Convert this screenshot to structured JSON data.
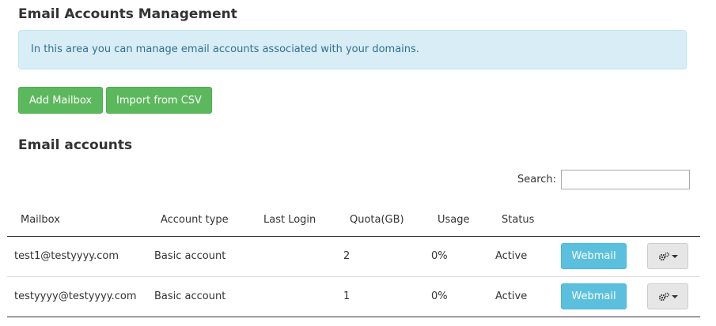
{
  "page": {
    "title": "Email Accounts Management",
    "info_text": "In this area you can manage email accounts associated with your domains."
  },
  "toolbar": {
    "add_label": "Add Mailbox",
    "import_label": "Import from CSV"
  },
  "accounts": {
    "section_title": "Email accounts",
    "search_label": "Search:",
    "search_value": "",
    "columns": [
      "Mailbox",
      "Account type",
      "Last Login",
      "Quota(GB)",
      "Usage",
      "Status"
    ],
    "rows": [
      {
        "mailbox": "test1@testyyyy.com",
        "account_type": "Basic account",
        "last_login": "",
        "quota": "2",
        "usage": "0%",
        "status": "Active",
        "webmail_label": "Webmail",
        "actions_icon": "gears-icon"
      },
      {
        "mailbox": "testyyyy@testyyyy.com",
        "account_type": "Basic account",
        "last_login": "",
        "quota": "1",
        "usage": "0%",
        "status": "Active",
        "webmail_label": "Webmail",
        "actions_icon": "gears-icon"
      }
    ]
  },
  "colors": {
    "success": "#5cb85c",
    "info_button": "#5bc0de",
    "info_bg": "#d9edf7",
    "info_text": "#31708f"
  }
}
